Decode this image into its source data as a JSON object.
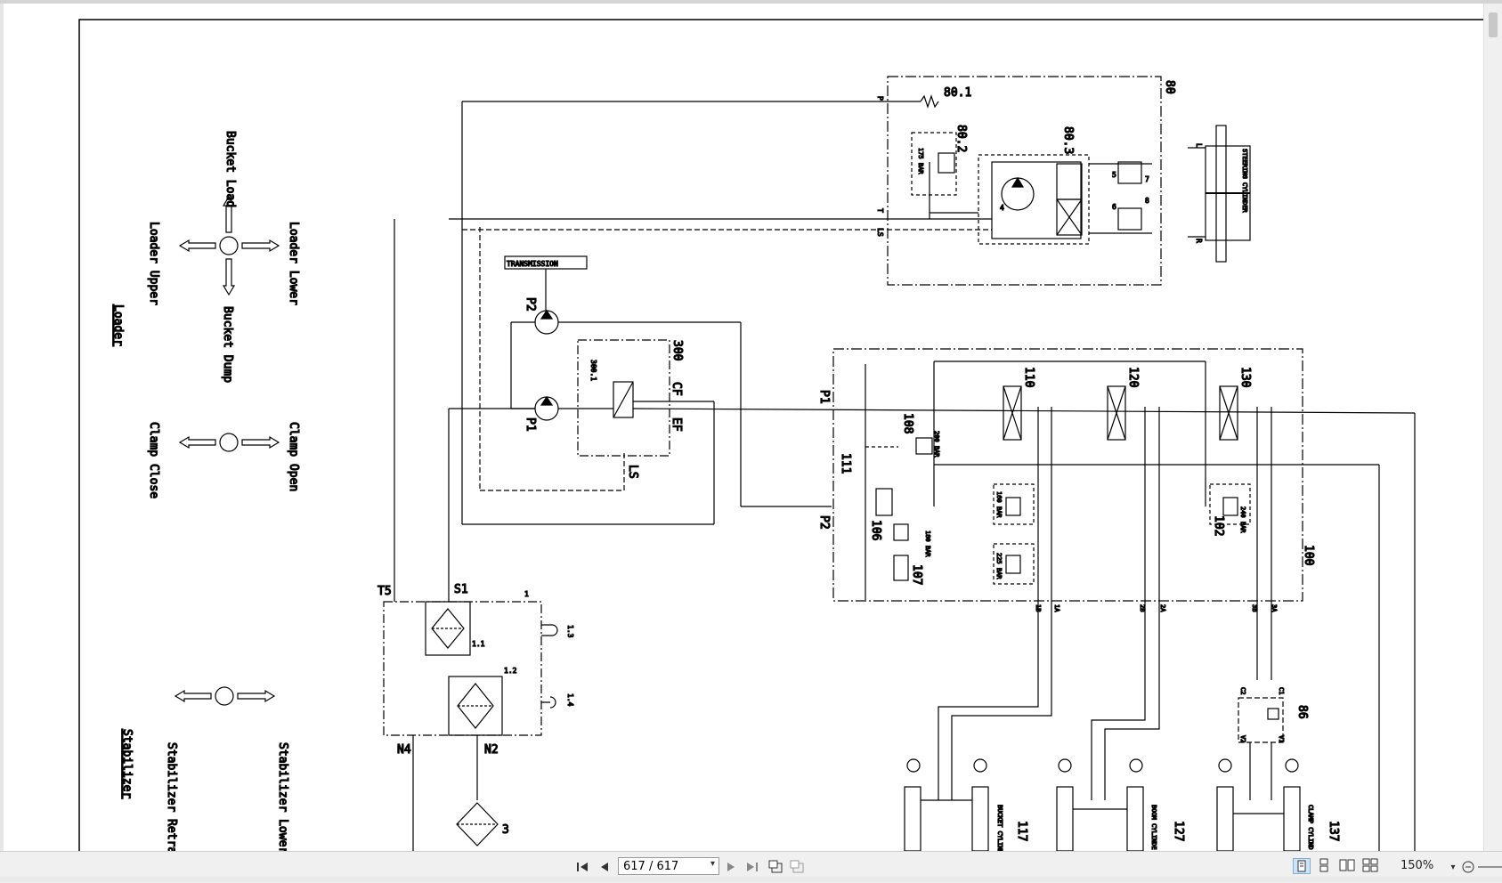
{
  "diagram": {
    "loader": {
      "title": "Loader",
      "bucket_load": "Bucket Load",
      "bucket_dump": "Bucket Dump",
      "loader_upper": "Loader Upper",
      "loader_lower": "Loader Lower",
      "clamp_close": "Clamp Close",
      "clamp_open": "Clamp Open"
    },
    "stabilizer": {
      "title": "Stabilizer",
      "retract": "Stabilizer Retract",
      "lower": "Stabilizer Lower"
    },
    "transmission": "TRANSMISSION",
    "steering_cylinder": "STEERING CYLINDER",
    "labels": {
      "n80": "80",
      "n80_1": "80.1",
      "n80_2": "80.2",
      "n80_3": "80.3",
      "bar175": "175 BAR",
      "P": "P",
      "T": "T",
      "LS": "LS",
      "L": "L",
      "R": "R",
      "n4": "4",
      "n5": "5",
      "n6": "6",
      "n7": "7",
      "n8": "8",
      "P2": "P2",
      "P1": "P1",
      "n300": "300",
      "n300_1": "300.1",
      "CF": "CF",
      "EF": "EF",
      "LS2": "LS",
      "P1b": "P1",
      "P2b": "P2",
      "n108": "108",
      "bar200": "200 BAR",
      "n111": "111",
      "n106": "106",
      "bar180": "180 BAR",
      "n107": "107",
      "n110": "110",
      "n120": "120",
      "n130": "130",
      "bar160": "160 BAR",
      "bar225": "225 BAR",
      "bar240": "240 BAR",
      "n102": "102",
      "n100": "100",
      "p1B": "1B",
      "p1A": "1A",
      "p2B": "2B",
      "p2A": "2A",
      "p3B": "3B",
      "p3A": "3A",
      "T5": "T5",
      "S1": "S1",
      "n1": "1",
      "n1_1": "1.1",
      "n1_2": "1.2",
      "n1_3": "1.3",
      "n1_4": "1.4",
      "N4": "N4",
      "N2": "N2",
      "n3": "3",
      "C2": "C2",
      "C1": "C1",
      "V2": "V2",
      "V1": "V1",
      "n86": "86",
      "n117": "117",
      "n127": "127",
      "n137": "137",
      "bucket_cyl": "BUCKET CYLIND",
      "boom_cyl": "BOOM CYLINDE",
      "clamp_cyl": "CLAMP CYLIND"
    }
  },
  "toolbar": {
    "page_value": "617 / 617",
    "zoom": "150%",
    "icons": [
      "first-page-icon",
      "prev-page-icon",
      "next-page-icon",
      "last-page-icon",
      "prev-view-icon",
      "next-view-icon",
      "single-page-icon",
      "continuous-icon",
      "facing-icon",
      "continuous-facing-icon",
      "zoom-dropdown-icon",
      "zoom-out-icon"
    ]
  }
}
